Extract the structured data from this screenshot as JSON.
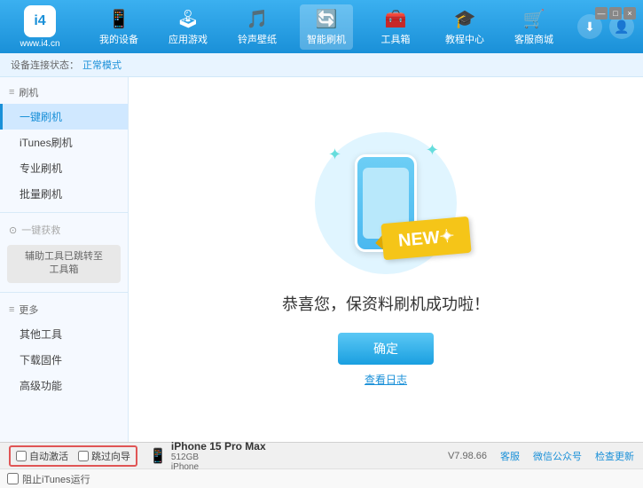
{
  "app": {
    "logo_text": "i4",
    "logo_subtitle": "www.i4.cn"
  },
  "nav": {
    "items": [
      {
        "id": "my-device",
        "label": "我的设备",
        "icon": "📱"
      },
      {
        "id": "app-game",
        "label": "应用游戏",
        "icon": "👤"
      },
      {
        "id": "ringtone",
        "label": "铃声壁纸",
        "icon": "🎵"
      },
      {
        "id": "smart-flash",
        "label": "智能刷机",
        "icon": "🔄",
        "active": true
      },
      {
        "id": "toolbox",
        "label": "工具箱",
        "icon": "🧰"
      },
      {
        "id": "tutorial",
        "label": "教程中心",
        "icon": "🎓"
      },
      {
        "id": "service",
        "label": "客服商城",
        "icon": "🛒"
      }
    ],
    "download_icon": "⬇",
    "user_icon": "👤"
  },
  "breadcrumb": {
    "prefix": "设备连接状态：",
    "mode_label": "正常模式"
  },
  "sidebar": {
    "section_flash": {
      "header": "刷机",
      "items": [
        {
          "id": "one-key-flash",
          "label": "一键刷机",
          "active": true
        },
        {
          "id": "itunes-flash",
          "label": "iTunes刷机"
        },
        {
          "id": "pro-flash",
          "label": "专业刷机"
        },
        {
          "id": "batch-flash",
          "label": "批量刷机"
        }
      ]
    },
    "section_recover": {
      "header": "一键获救",
      "disabled": true,
      "notice": "辅助工具已跳转至\n工具箱"
    },
    "section_more": {
      "header": "更多",
      "items": [
        {
          "id": "other-tools",
          "label": "其他工具"
        },
        {
          "id": "download-firmware",
          "label": "下载固件"
        },
        {
          "id": "advanced",
          "label": "高级功能"
        }
      ]
    }
  },
  "content": {
    "success_message": "恭喜您，保资料刷机成功啦！",
    "confirm_btn": "确定",
    "view_log": "查看日志"
  },
  "bottom": {
    "auto_activate_label": "自动激活",
    "guide_activate_label": "跳过向导",
    "device_name": "iPhone 15 Pro Max",
    "device_storage": "512GB",
    "device_type": "iPhone",
    "version": "V7.98.66",
    "links": [
      "客服",
      "微信公众号",
      "检查更新"
    ],
    "stop_itunes": "阻止iTunes运行",
    "window_controls": [
      "—",
      "□",
      "×"
    ]
  }
}
